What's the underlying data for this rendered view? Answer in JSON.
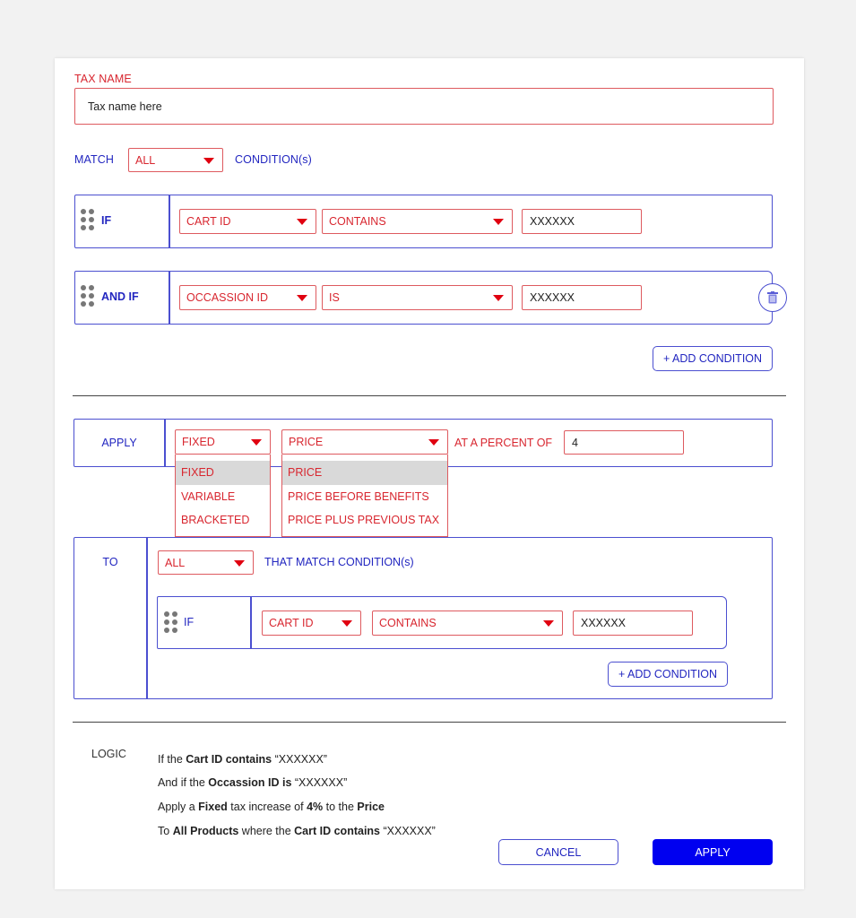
{
  "tax_name": {
    "label": "TAX NAME",
    "value": "Tax name here"
  },
  "match": {
    "label": "MATCH",
    "selected": "ALL",
    "suffix": "CONDITION(s)"
  },
  "conditions": [
    {
      "prefix": "IF",
      "field": "CART ID",
      "operator": "CONTAINS",
      "value": "XXXXXX"
    },
    {
      "prefix": "AND IF",
      "field": "OCCASSION ID",
      "operator": "IS",
      "value": "XXXXXX"
    }
  ],
  "add_condition_label": "+ ADD CONDITION",
  "apply_section": {
    "label": "APPLY",
    "type_selected": "FIXED",
    "type_options": [
      "FIXED",
      "VARIABLE",
      "BRACKETED"
    ],
    "base_selected": "PRICE",
    "base_options": [
      "PRICE",
      "PRICE BEFORE BENEFITS",
      "PRICE PLUS PREVIOUS TAX"
    ],
    "percent_label": "AT A PERCENT OF",
    "percent_value": "4"
  },
  "to_section": {
    "label": "TO",
    "match_selected": "ALL",
    "suffix": "THAT MATCH CONDITION(s)",
    "conditions": [
      {
        "prefix": "IF",
        "field": "CART ID",
        "operator": "CONTAINS",
        "value": "XXXXXX"
      }
    ],
    "add_condition_label": "+ ADD CONDITION"
  },
  "logic": {
    "label": "LOGIC",
    "lines": [
      [
        {
          "t": "If the "
        },
        {
          "t": "Cart ID contains",
          "b": true
        },
        {
          "t": " “XXXXXX”"
        }
      ],
      [
        {
          "t": "And if the "
        },
        {
          "t": "Occassion ID is",
          "b": true
        },
        {
          "t": " “XXXXXX”"
        }
      ],
      [
        {
          "t": "Apply a "
        },
        {
          "t": "Fixed",
          "b": true
        },
        {
          "t": " tax increase of "
        },
        {
          "t": "4%",
          "b": true
        },
        {
          "t": " to the "
        },
        {
          "t": "Price",
          "b": true
        }
      ],
      [
        {
          "t": "To "
        },
        {
          "t": "All Products",
          "b": true
        },
        {
          "t": " where the "
        },
        {
          "t": "Cart ID contains",
          "b": true
        },
        {
          "t": " “XXXXXX”"
        }
      ]
    ]
  },
  "footer": {
    "cancel_label": "CANCEL",
    "apply_label": "APPLY"
  },
  "colors": {
    "accent_blue": "#0000f0",
    "field_red": "#d8262f"
  }
}
